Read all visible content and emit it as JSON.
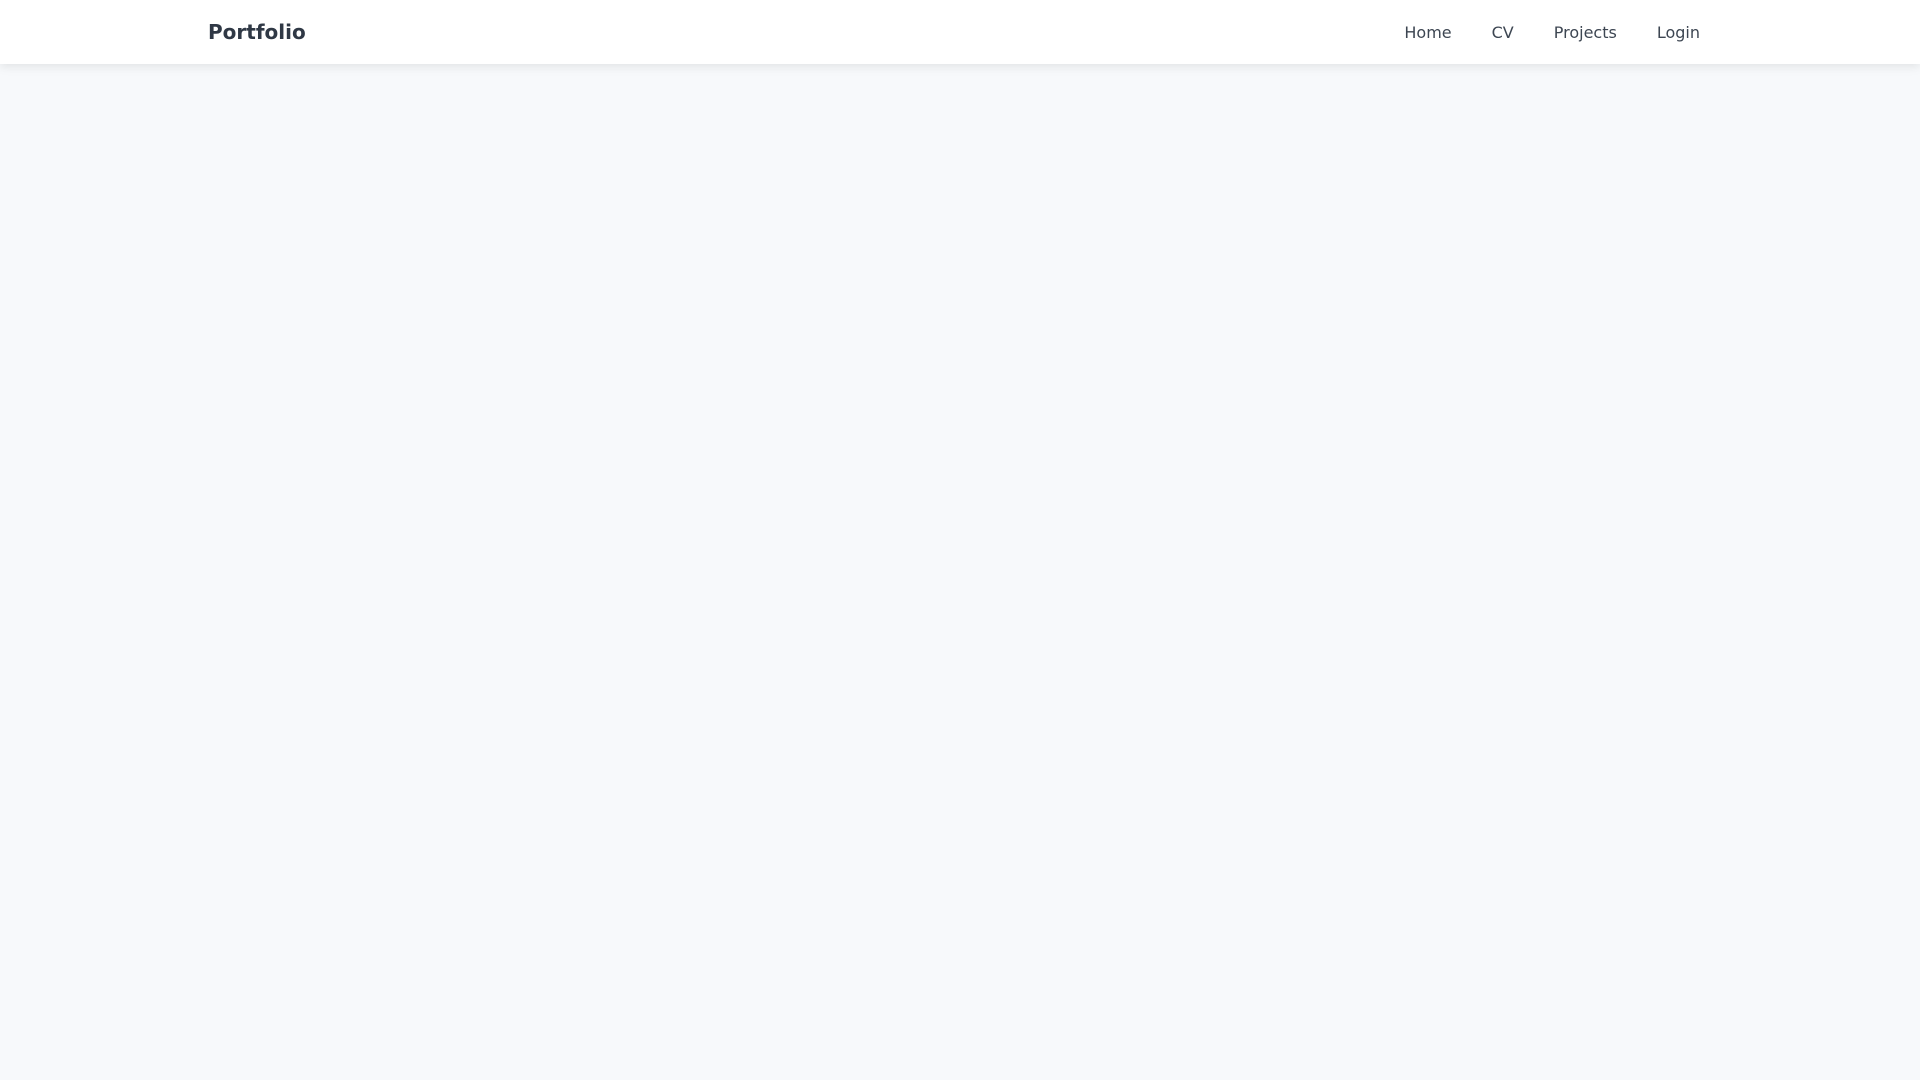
{
  "header": {
    "brand": "Portfolio",
    "nav": [
      {
        "label": "Home"
      },
      {
        "label": "CV"
      },
      {
        "label": "Projects"
      },
      {
        "label": "Login"
      }
    ]
  },
  "colors": {
    "background": "#f7f9fb",
    "navbar": "#ffffff",
    "text": "#333d4a"
  }
}
